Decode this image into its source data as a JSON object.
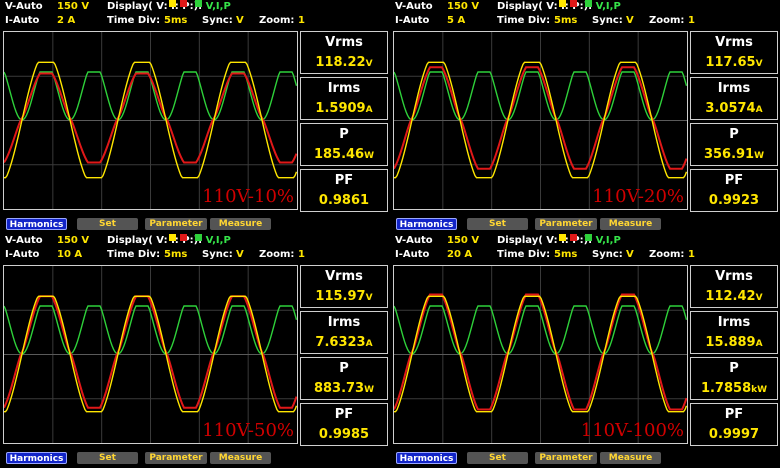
{
  "header_labels": {
    "v_auto": "V-Auto",
    "i_auto": "I-Auto",
    "display": "Display( V:",
    "display_i": "I:",
    "display_p": "P:",
    "display_close": "):",
    "display_value": "V,I,P",
    "time_div": "Time  Div:",
    "time_div_value": "5ms",
    "sync": "Sync:",
    "sync_value": "V",
    "zoom": "Zoom:",
    "zoom_value": "1"
  },
  "measure_labels": {
    "vrms": "Vrms",
    "irms": "Irms",
    "p": "P",
    "pf": "PF"
  },
  "buttons": {
    "harmonics": "Harmonics",
    "set": "Set",
    "parameter": "Parameter",
    "measure": "Measure"
  },
  "colors": {
    "voltage": "#ffe600",
    "current": "#e01818",
    "power": "#2ed13a",
    "label": "#d00000"
  },
  "panels": [
    {
      "v_range": "150  V",
      "i_range": "2  A",
      "vrms": "118.22",
      "vrms_unit": "V",
      "irms": "1.5909",
      "irms_unit": "A",
      "p": "185.46",
      "p_unit": "W",
      "pf": "0.9861",
      "label": "110V-10%"
    },
    {
      "v_range": "150  V",
      "i_range": "5  A",
      "vrms": "117.65",
      "vrms_unit": "V",
      "irms": "3.0574",
      "irms_unit": "A",
      "p": "356.91",
      "p_unit": "W",
      "pf": "0.9923",
      "label": "110V-20%"
    },
    {
      "v_range": "150  V",
      "i_range": "10  A",
      "vrms": "115.97",
      "vrms_unit": "V",
      "irms": "7.6323",
      "irms_unit": "A",
      "p": "883.73",
      "p_unit": "W",
      "pf": "0.9985",
      "label": "110V-50%"
    },
    {
      "v_range": "150  V",
      "i_range": "20  A",
      "vrms": "112.42",
      "vrms_unit": "V",
      "irms": "15.889",
      "irms_unit": "A",
      "p": "1.7858",
      "p_unit": "kW",
      "pf": "0.9997",
      "label": "110V-100%"
    }
  ]
}
